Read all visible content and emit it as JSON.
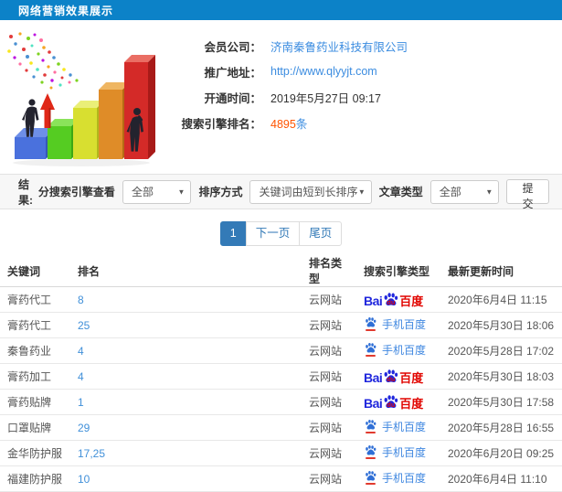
{
  "topbar": {
    "title": "网络营销效果展示"
  },
  "info": {
    "company_label": "会员公司：",
    "company_value": "济南秦鲁药业科技有限公司",
    "url_label": "推广地址：",
    "url_value": "http://www.qlyyjt.com",
    "opened_label": "开通时间：",
    "opened_value": "2019年5月27日 09:17",
    "rank_label": "搜索引擎排名：",
    "rank_count": "4895",
    "rank_unit": "条"
  },
  "filters": {
    "section_label": "结果:",
    "engine_label": "分搜索引擎查看",
    "engine_value": "全部",
    "sort_label": "排序方式",
    "sort_value": "关键词由短到长排序",
    "article_label": "文章类型",
    "article_value": "全部",
    "submit_label": "提交",
    "caret": "▼"
  },
  "pagination": {
    "current": "1",
    "next_label": "下一页",
    "last_label": "尾页"
  },
  "engines": {
    "baidu_pc": {
      "bai": "Bai",
      "du": "du",
      "cn": "百度"
    },
    "baidu_mobile": {
      "label": "手机百度"
    }
  },
  "table": {
    "headers": [
      "关键词",
      "排名",
      "排名类型",
      "搜索引擎类型",
      "最新更新时间"
    ],
    "rows": [
      {
        "keyword": "膏药代工",
        "rank": "8",
        "type": "云网站",
        "engine": "百度",
        "updated": "2020年6月4日 11:15"
      },
      {
        "keyword": "膏药代工",
        "rank": "25",
        "type": "云网站",
        "engine": "手机百度",
        "updated": "2020年5月30日 18:06"
      },
      {
        "keyword": "秦鲁药业",
        "rank": "4",
        "type": "云网站",
        "engine": "手机百度",
        "updated": "2020年5月28日 17:02"
      },
      {
        "keyword": "膏药加工",
        "rank": "4",
        "type": "云网站",
        "engine": "百度",
        "updated": "2020年5月30日 18:03"
      },
      {
        "keyword": "膏药贴牌",
        "rank": "1",
        "type": "云网站",
        "engine": "百度",
        "updated": "2020年5月30日 17:58"
      },
      {
        "keyword": "口罩贴牌",
        "rank": "29",
        "type": "云网站",
        "engine": "手机百度",
        "updated": "2020年5月28日 16:55"
      },
      {
        "keyword": "金华防护服",
        "rank": "17,25",
        "type": "云网站",
        "engine": "手机百度",
        "updated": "2020年6月20日 09:25"
      },
      {
        "keyword": "福建防护服",
        "rank": "10",
        "type": "云网站",
        "engine": "手机百度",
        "updated": "2020年6月4日 11:10"
      }
    ]
  },
  "colors": {
    "topbar_blue": "#0c82c8",
    "link_blue": "#3b8ce0",
    "count_red": "#ff5400",
    "pagination_blue": "#337ab7",
    "baidu_blue": "#2027dd",
    "baidu_red": "#e10500"
  }
}
